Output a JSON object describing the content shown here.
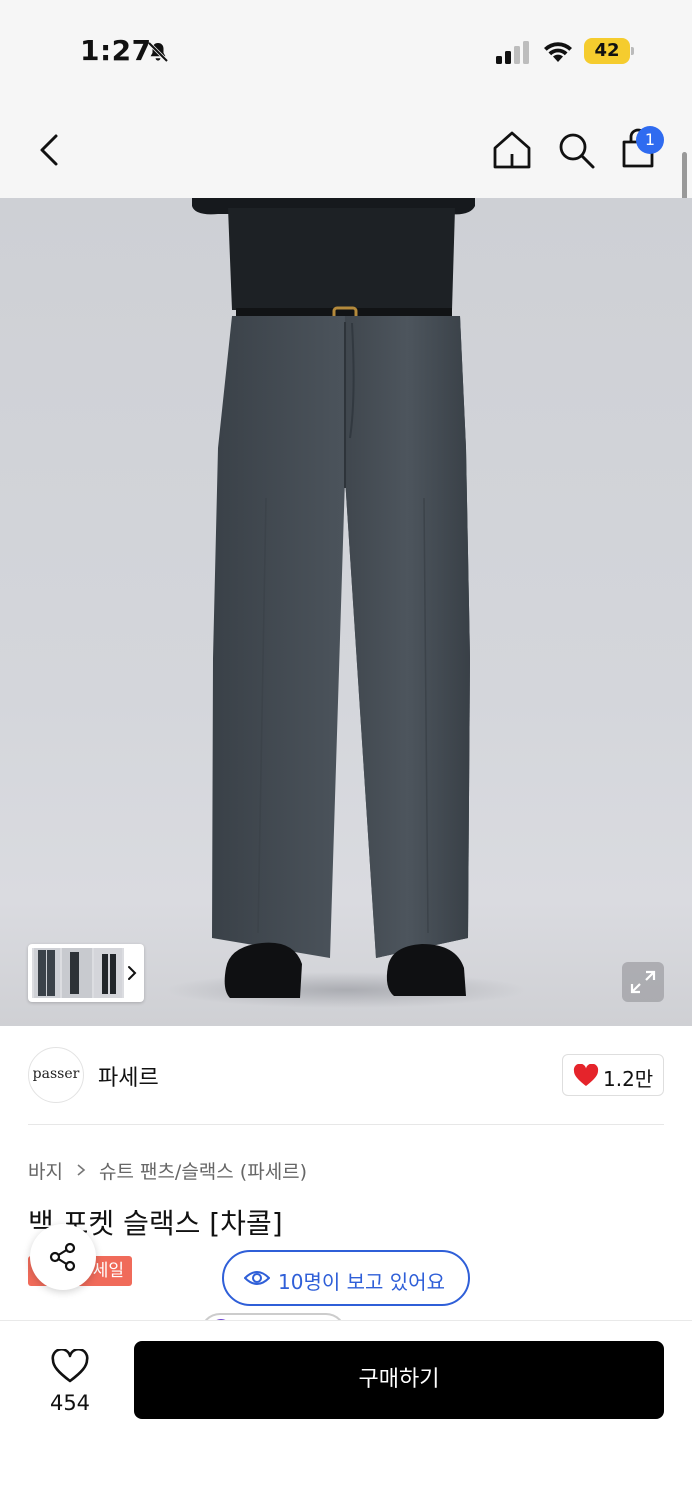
{
  "status_bar": {
    "time": "1:27",
    "battery": "42"
  },
  "nav": {
    "cart_count": "1"
  },
  "brand": {
    "logo_text": "passer",
    "name": "파세르",
    "like_count": "1.2만"
  },
  "breadcrumb": {
    "category": "바지",
    "subcategory": "슈트 팬츠/슬랙스 (파세르)"
  },
  "product": {
    "title": "백 포켓 슬랙스 [차콜]",
    "sale_badge": "세일"
  },
  "viewers": {
    "text": "10명이 보고 있어요"
  },
  "bottom": {
    "wish_count": "454",
    "buy_label": "구매하기"
  },
  "colors": {
    "accent_blue": "#2f5fd8",
    "badge_blue": "#2f6bf0",
    "sale_red": "#f06b5a",
    "heart_red": "#e5242b",
    "battery_yellow": "#f5cc2e"
  }
}
